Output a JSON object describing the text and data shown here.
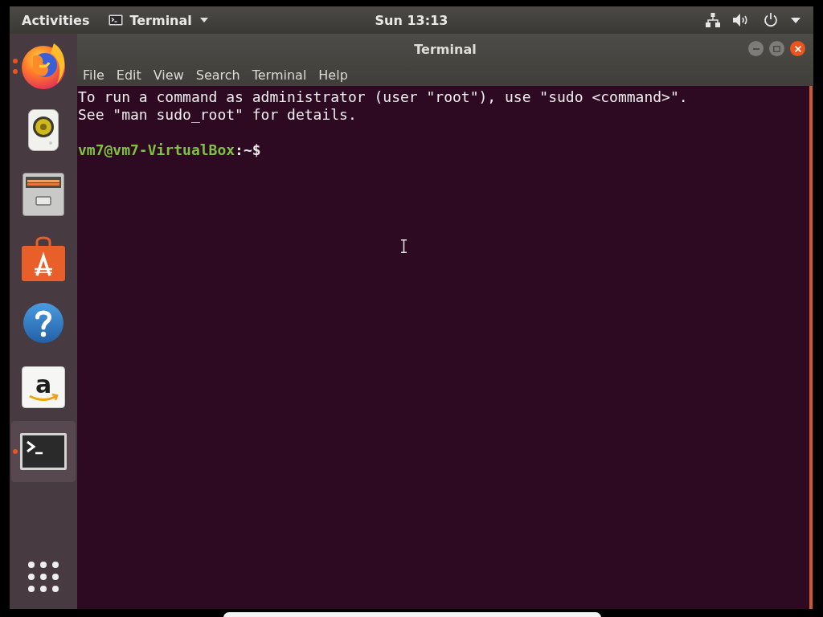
{
  "top_bar": {
    "activities": "Activities",
    "app_menu": "Terminal",
    "clock": "Sun 13:13"
  },
  "dock": {
    "items": [
      {
        "kind": "browser",
        "running": true,
        "multiple_windows": true,
        "selected": false
      },
      {
        "kind": "music",
        "running": false,
        "selected": false
      },
      {
        "kind": "files",
        "running": false,
        "selected": false
      },
      {
        "kind": "software",
        "running": false,
        "selected": false
      },
      {
        "kind": "help",
        "running": false,
        "selected": false
      },
      {
        "kind": "store",
        "glyph": "a",
        "running": false,
        "selected": false
      },
      {
        "kind": "terminal",
        "running": true,
        "multiple_windows": false,
        "selected": true
      }
    ]
  },
  "window": {
    "title": "Terminal",
    "menu": [
      "File",
      "Edit",
      "View",
      "Search",
      "Terminal",
      "Help"
    ],
    "lines": [
      {
        "kind": "output",
        "text": "To run a command as administrator (user \"root\"), use \"sudo <command>\"."
      },
      {
        "kind": "output",
        "text": "See \"man sudo_root\" for details."
      },
      {
        "kind": "blank"
      },
      {
        "kind": "prompt",
        "user_host": "vm7@vm7-VirtualBox",
        "path": ":~$"
      }
    ]
  }
}
